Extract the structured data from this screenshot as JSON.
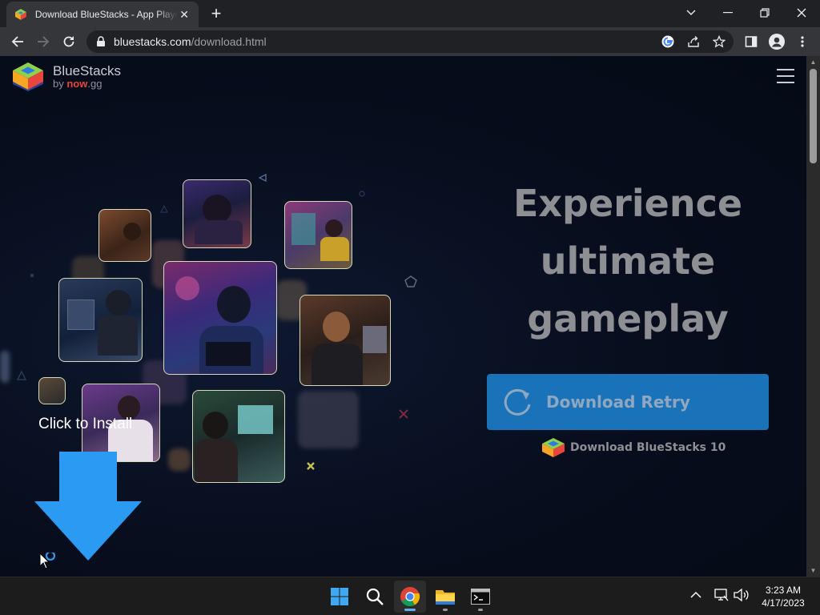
{
  "browser": {
    "tab": {
      "title": "Download BlueStacks - App Player"
    },
    "address": {
      "host": "bluestacks.com",
      "path": "/download.html"
    }
  },
  "page": {
    "logo": {
      "name": "BlueStacks",
      "by": "by",
      "brand_bold": "now",
      "brand_rest": ".gg"
    },
    "hero_title_lines": [
      "Experience",
      "ultimate",
      "gameplay"
    ],
    "download_button": "Download Retry",
    "download_bs10": "Download BlueStacks 10",
    "click_to_install": "Click to Install"
  },
  "taskbar": {
    "time": "3:23 AM",
    "date": "4/17/2023"
  },
  "colors": {
    "accent_blue": "#1a73b8",
    "arrow_blue": "#2b9af3",
    "page_bg": "#070d1c"
  }
}
